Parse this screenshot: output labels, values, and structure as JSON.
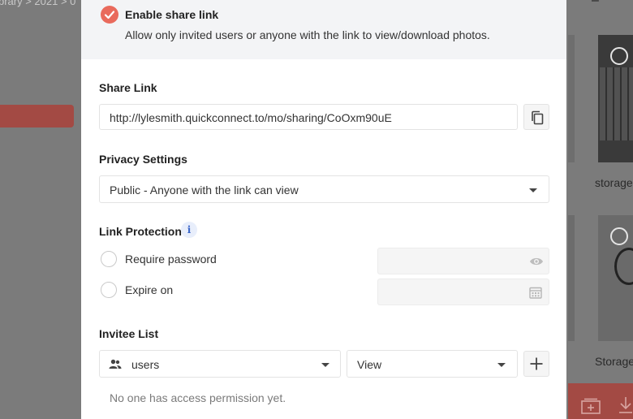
{
  "background": {
    "breadcrumb": "brary > 2021 > 0",
    "caption_top": "storage",
    "caption_bottom": "Storage"
  },
  "share": {
    "enable_title": "Enable share link",
    "enable_description": "Allow only invited users or anyone with the link to view/download photos.",
    "enabled": true,
    "share_link_label": "Share Link",
    "share_link_url": "http://lylesmith.quickconnect.to/mo/sharing/CoOxm90uE",
    "privacy_label": "Privacy Settings",
    "privacy_value": "Public - Anyone with the link can view",
    "protection_label": "Link Protection",
    "info_glyph": "i",
    "require_password_label": "Require password",
    "expire_on_label": "Expire on",
    "invitee_label": "Invitee List",
    "invitee_type_value": "users",
    "permission_value": "View",
    "empty_message": "No one has access permission yet."
  },
  "icons": {
    "enable": "check-icon",
    "copy": "copy-icon",
    "dropdown": "caret-down-icon",
    "info": "info-icon",
    "password": "eye-icon",
    "date": "calendar-icon",
    "users": "users-icon",
    "add": "plus-icon"
  },
  "colors": {
    "accent": "#e96a5c",
    "background_accent": "#a34a44",
    "info": "#3a66c9"
  }
}
